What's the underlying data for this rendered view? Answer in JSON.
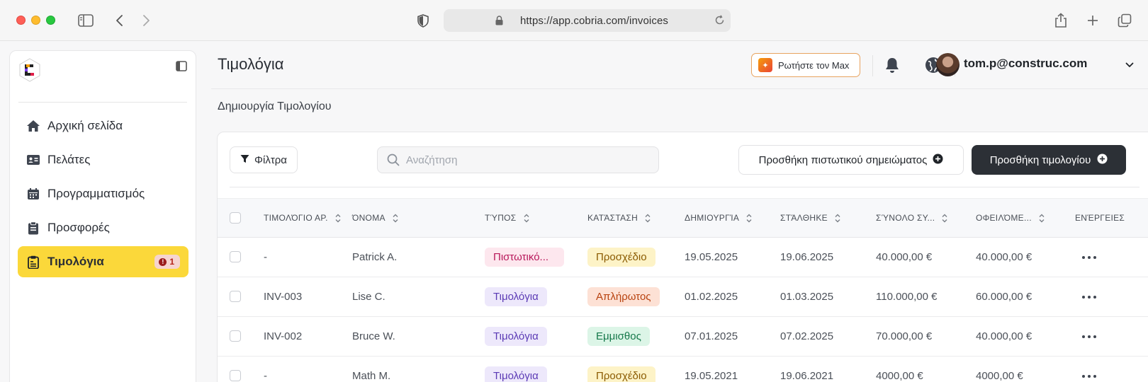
{
  "browser": {
    "url": "https://app.cobria.com/invoices"
  },
  "sidebar": {
    "items": [
      {
        "label": "Αρχική σελίδα",
        "icon": "home-icon"
      },
      {
        "label": "Πελάτες",
        "icon": "contact-card-icon"
      },
      {
        "label": "Προγραμματισμός",
        "icon": "calendar-icon"
      },
      {
        "label": "Προσφορές",
        "icon": "clipboard-icon"
      },
      {
        "label": "Τιμολόγια",
        "icon": "invoice-icon",
        "active": true,
        "badge": "1"
      }
    ]
  },
  "header": {
    "title": "Τιμολόγια",
    "ask_max_label": "Ρωτήστε τον Max",
    "user_email": "tom.p@construc.com"
  },
  "main": {
    "subtitle": "Δημιουργία Τιμολογίου",
    "filter_label": "Φίλτρα",
    "search_placeholder": "Αναζήτηση",
    "add_credit_note_label": "Προσθήκη πιστωτικού σημειώματος",
    "add_invoice_label": "Προσθήκη τιμολογίου"
  },
  "table": {
    "columns": [
      "ΤΙΜΟΛΌΓΙΟ ΑΡ.",
      "ΌΝΟΜΑ",
      "ΤΎΠΟΣ",
      "ΚΑΤΆΣΤΑΣΗ",
      "ΔΗΜΙΟΥΡΓΊΑ",
      "ΣΤΆΛΘΗΚΕ",
      "ΣΎΝΟΛΟ ΣΥ...",
      "ΟΦΕΙΛΌΜΕ...",
      "ΕΝΈΡΓΕΙΕΣ"
    ],
    "rows": [
      {
        "number": "-",
        "name": "Patrick A.",
        "type": "Πιστωτικό...",
        "status": "Προσχέδιο",
        "created": "19.05.2025",
        "sent": "19.06.2025",
        "total": "40.000,00 €",
        "due": "40.000,00 €"
      },
      {
        "number": "INV-003",
        "name": "Lise C.",
        "type": "Τιμολόγια",
        "status": "Απλήρωτος",
        "created": "01.02.2025",
        "sent": "01.03.2025",
        "total": "110.000,00 €",
        "due": "60.000,00 €"
      },
      {
        "number": "INV-002",
        "name": "Bruce W.",
        "type": "Τιμολόγια",
        "status": "Εμμισθος",
        "created": "07.01.2025",
        "sent": "07.02.2025",
        "total": "70.000,00 €",
        "due": "40.000,00 €"
      },
      {
        "number": "-",
        "name": "Math M.",
        "type": "Τιμολόγια",
        "status": "Προσχέδιο",
        "created": "19.05.2021",
        "sent": "19.06.2021",
        "total": "4000,00 €",
        "due": "4000,00 €"
      }
    ]
  },
  "colors": {
    "active_nav": "#fbd83a",
    "primary_button": "#2c3036",
    "ask_max_border": "#e8a35f"
  }
}
